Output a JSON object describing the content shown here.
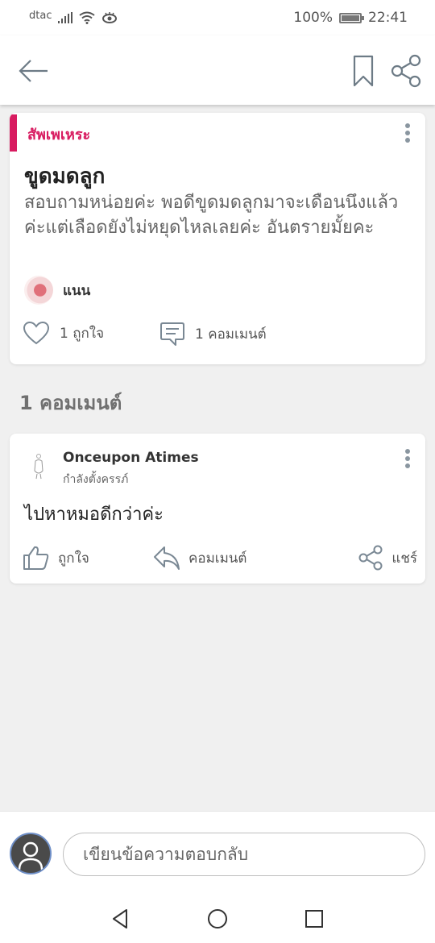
{
  "status_bar": {
    "carrier": "dtac",
    "battery": "100%",
    "time": "22:41"
  },
  "header": {
    "back_icon": "arrow-left-icon",
    "bookmark_icon": "bookmark-icon",
    "share_icon": "share-icon"
  },
  "post": {
    "category": "สัพเพเหระ",
    "category_color": "#d81b60",
    "title": "ขูดมดลูก",
    "body": "สอบถามหน่อยค่ะ พอดีขูดมดลูกมาจะเดือนนึงแล้วค่ะแต่เลือดยังไม่หยุดไหลเลยค่ะ อันตรายมั้ยคะ",
    "author": "แนน",
    "likes": "1 ถูกใจ",
    "comments": "1 คอมเมนต์"
  },
  "comments_heading": "1 คอมเมนต์",
  "comment": {
    "author": "Onceupon Atimes",
    "status": "กำลังตั้งครรภ์",
    "text": "ไปหาหมอดีกว่าค่ะ",
    "like_label": "ถูกใจ",
    "reply_label": "คอมเมนต์",
    "share_label": "แชร์"
  },
  "reply_bar": {
    "placeholder": "เขียนข้อความตอบกลับ"
  },
  "nav": {
    "back_icon": "nav-back-icon",
    "home_icon": "nav-home-icon",
    "recent_icon": "nav-recent-icon"
  }
}
